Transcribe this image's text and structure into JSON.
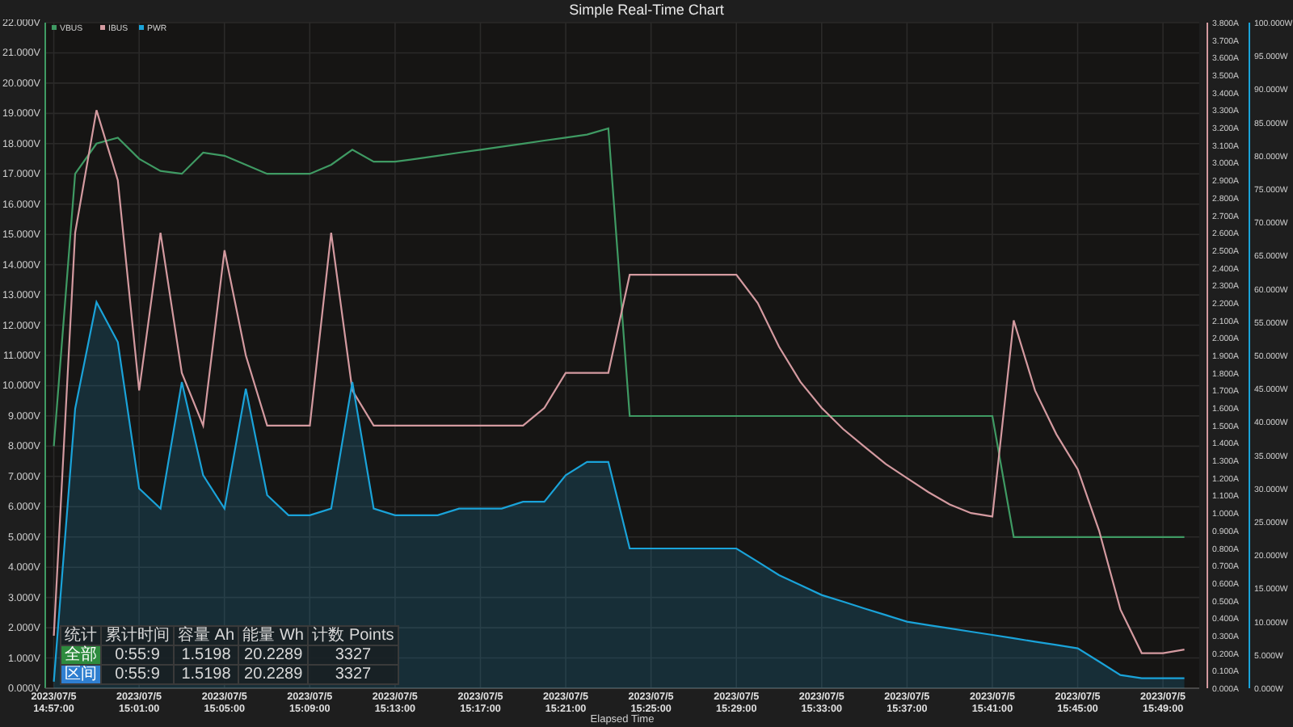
{
  "title": "Simple Real-Time Chart",
  "chart_data": {
    "type": "line",
    "xlabel": "Elapsed Time",
    "ylim": [
      0,
      22
    ],
    "grid": true,
    "legend": true,
    "categories": [
      "2023/07/5\n14:57:00",
      null,
      null,
      null,
      "2023/07/5\n15:01:00",
      null,
      null,
      null,
      "2023/07/5\n15:05:00",
      null,
      null,
      null,
      "2023/07/5\n15:09:00",
      null,
      null,
      null,
      "2023/07/5\n15:13:00",
      null,
      null,
      null,
      "2023/07/5\n15:17:00",
      null,
      null,
      null,
      "2023/07/5\n15:21:00",
      null,
      null,
      null,
      "2023/07/5\n15:25:00",
      null,
      null,
      null,
      "2023/07/5\n15:29:00",
      null,
      null,
      null,
      "2023/07/5\n15:33:00",
      null,
      null,
      null,
      "2023/07/5\n15:37:00",
      null,
      null,
      null,
      "2023/07/5\n15:41:00",
      null,
      null,
      null,
      "2023/07/5\n15:45:00",
      null,
      null,
      null,
      "2023/07/5\n15:49:00",
      null
    ],
    "yticks": [
      {
        "value": 0,
        "label": "0.000V"
      },
      {
        "value": 1,
        "label": "1.000V"
      },
      {
        "value": 2,
        "label": "2.000V"
      },
      {
        "value": 3,
        "label": "3.000V"
      },
      {
        "value": 4,
        "label": "4.000V"
      },
      {
        "value": 5,
        "label": "5.000V"
      },
      {
        "value": 6,
        "label": "6.000V"
      },
      {
        "value": 7,
        "label": "7.000V"
      },
      {
        "value": 8,
        "label": "8.000V"
      },
      {
        "value": 9,
        "label": "9.000V"
      },
      {
        "value": 10,
        "label": "10.000V"
      },
      {
        "value": 11,
        "label": "11.000V"
      },
      {
        "value": 12,
        "label": "12.000V"
      },
      {
        "value": 13,
        "label": "13.000V"
      },
      {
        "value": 14,
        "label": "14.000V"
      },
      {
        "value": 15,
        "label": "15.000V"
      },
      {
        "value": 16,
        "label": "16.000V"
      },
      {
        "value": 17,
        "label": "17.000V"
      },
      {
        "value": 18,
        "label": "18.000V"
      },
      {
        "value": 19,
        "label": "19.000V"
      },
      {
        "value": 20,
        "label": "20.000V"
      },
      {
        "value": 21,
        "label": "21.000V"
      },
      {
        "value": 22,
        "label": "22.000V"
      }
    ],
    "y2lim": [
      0,
      3.8
    ],
    "y2ticks": [
      {
        "value": 0,
        "label": "0.000A"
      },
      {
        "value": 0.1,
        "label": "0.100A"
      },
      {
        "value": 0.2,
        "label": "0.200A"
      },
      {
        "value": 0.3,
        "label": "0.300A"
      },
      {
        "value": 0.4,
        "label": "0.400A"
      },
      {
        "value": 0.5,
        "label": "0.500A"
      },
      {
        "value": 0.6,
        "label": "0.600A"
      },
      {
        "value": 0.7,
        "label": "0.700A"
      },
      {
        "value": 0.8,
        "label": "0.800A"
      },
      {
        "value": 0.9,
        "label": "0.900A"
      },
      {
        "value": 1.0,
        "label": "1.000A"
      },
      {
        "value": 1.1,
        "label": "1.100A"
      },
      {
        "value": 1.2,
        "label": "1.200A"
      },
      {
        "value": 1.3,
        "label": "1.300A"
      },
      {
        "value": 1.4,
        "label": "1.400A"
      },
      {
        "value": 1.5,
        "label": "1.500A"
      },
      {
        "value": 1.6,
        "label": "1.600A"
      },
      {
        "value": 1.7,
        "label": "1.700A"
      },
      {
        "value": 1.8,
        "label": "1.800A"
      },
      {
        "value": 1.9,
        "label": "1.900A"
      },
      {
        "value": 2.0,
        "label": "2.000A"
      },
      {
        "value": 2.1,
        "label": "2.100A"
      },
      {
        "value": 2.2,
        "label": "2.200A"
      },
      {
        "value": 2.3,
        "label": "2.300A"
      },
      {
        "value": 2.4,
        "label": "2.400A"
      },
      {
        "value": 2.5,
        "label": "2.500A"
      },
      {
        "value": 2.6,
        "label": "2.600A"
      },
      {
        "value": 2.7,
        "label": "2.700A"
      },
      {
        "value": 2.8,
        "label": "2.800A"
      },
      {
        "value": 2.9,
        "label": "2.900A"
      },
      {
        "value": 3.0,
        "label": "3.000A"
      },
      {
        "value": 3.1,
        "label": "3.100A"
      },
      {
        "value": 3.2,
        "label": "3.200A"
      },
      {
        "value": 3.3,
        "label": "3.300A"
      },
      {
        "value": 3.4,
        "label": "3.400A"
      },
      {
        "value": 3.5,
        "label": "3.500A"
      },
      {
        "value": 3.6,
        "label": "3.600A"
      },
      {
        "value": 3.7,
        "label": "3.700A"
      },
      {
        "value": 3.8,
        "label": "3.800A"
      }
    ],
    "y3lim": [
      0,
      100
    ],
    "y3ticks": [
      {
        "value": 0,
        "label": "0.000W"
      },
      {
        "value": 5,
        "label": "5.000W"
      },
      {
        "value": 10,
        "label": "10.000W"
      },
      {
        "value": 15,
        "label": "15.000W"
      },
      {
        "value": 20,
        "label": "20.000W"
      },
      {
        "value": 25,
        "label": "25.000W"
      },
      {
        "value": 30,
        "label": "30.000W"
      },
      {
        "value": 35,
        "label": "35.000W"
      },
      {
        "value": 40,
        "label": "40.000W"
      },
      {
        "value": 45,
        "label": "45.000W"
      },
      {
        "value": 50,
        "label": "50.000W"
      },
      {
        "value": 55,
        "label": "55.000W"
      },
      {
        "value": 60,
        "label": "60.000W"
      },
      {
        "value": 65,
        "label": "65.000W"
      },
      {
        "value": 70,
        "label": "70.000W"
      },
      {
        "value": 75,
        "label": "75.000W"
      },
      {
        "value": 80,
        "label": "80.000W"
      },
      {
        "value": 85,
        "label": "85.000W"
      },
      {
        "value": 90,
        "label": "90.000W"
      },
      {
        "value": 95,
        "label": "95.000W"
      },
      {
        "value": 100,
        "label": "100.000W"
      }
    ],
    "series": [
      {
        "name": "VBUS",
        "color": "#3f9a63",
        "type": "line",
        "values": [
          8,
          17.0,
          18.0,
          18.2,
          17.5,
          17.1,
          17.0,
          17.7,
          17.6,
          17.3,
          17.0,
          17.0,
          17.0,
          17.3,
          17.8,
          17.4,
          17.4,
          17.5,
          17.6,
          17.7,
          17.8,
          17.9,
          18.0,
          18.1,
          18.2,
          18.3,
          18.5,
          9.0,
          9.0,
          9.0,
          9.0,
          9.0,
          9.0,
          9.0,
          9.0,
          9.0,
          9.0,
          9.0,
          9.0,
          9.0,
          9.0,
          9.0,
          9.0,
          9.0,
          9.0,
          5.0,
          5.0,
          5.0,
          5.0,
          5.0,
          5.0,
          5.0,
          5.0,
          5.0
        ]
      },
      {
        "name": "IBUS",
        "color": "#d49aa0",
        "type": "line",
        "axis": "y2",
        "values": [
          0.3,
          2.6,
          3.3,
          2.9,
          1.7,
          2.6,
          1.8,
          1.5,
          2.5,
          1.9,
          1.5,
          1.5,
          1.5,
          2.6,
          1.7,
          1.5,
          1.5,
          1.5,
          1.5,
          1.5,
          1.5,
          1.5,
          1.5,
          1.6,
          1.8,
          1.8,
          1.8,
          2.36,
          2.36,
          2.36,
          2.36,
          2.36,
          2.36,
          2.2,
          1.95,
          1.75,
          1.6,
          1.48,
          1.38,
          1.28,
          1.2,
          1.12,
          1.05,
          1.0,
          0.98,
          2.1,
          1.7,
          1.45,
          1.25,
          0.9,
          0.45,
          0.2,
          0.2,
          0.22
        ]
      },
      {
        "name": "PWR",
        "color": "#1aa3d9",
        "type": "area",
        "axis": "y3",
        "values": [
          1,
          42,
          58,
          52,
          30,
          27,
          46,
          32,
          27,
          45,
          29,
          26,
          26,
          27,
          46,
          27,
          26,
          26,
          26,
          27,
          27,
          27,
          28,
          28,
          32,
          34,
          34,
          21,
          21,
          21,
          21,
          21,
          21,
          19,
          17,
          15.5,
          14,
          13,
          12,
          11,
          10,
          9.5,
          9,
          8.5,
          8,
          7.5,
          7,
          6.5,
          6,
          4,
          2,
          1.5,
          1.5,
          1.5
        ]
      }
    ]
  },
  "stats_table": {
    "columns": [
      "统计",
      "累计时间",
      "容量 Ah",
      "能量 Wh",
      "计数 Points"
    ],
    "rows": [
      {
        "color": "#2e8b3e",
        "cells": [
          "全部",
          "0:55:9",
          "1.5198",
          "20.2289",
          "3327"
        ]
      },
      {
        "color": "#2f7fd0",
        "cells": [
          "区间",
          "0:55:9",
          "1.5198",
          "20.2289",
          "3327"
        ]
      }
    ]
  }
}
